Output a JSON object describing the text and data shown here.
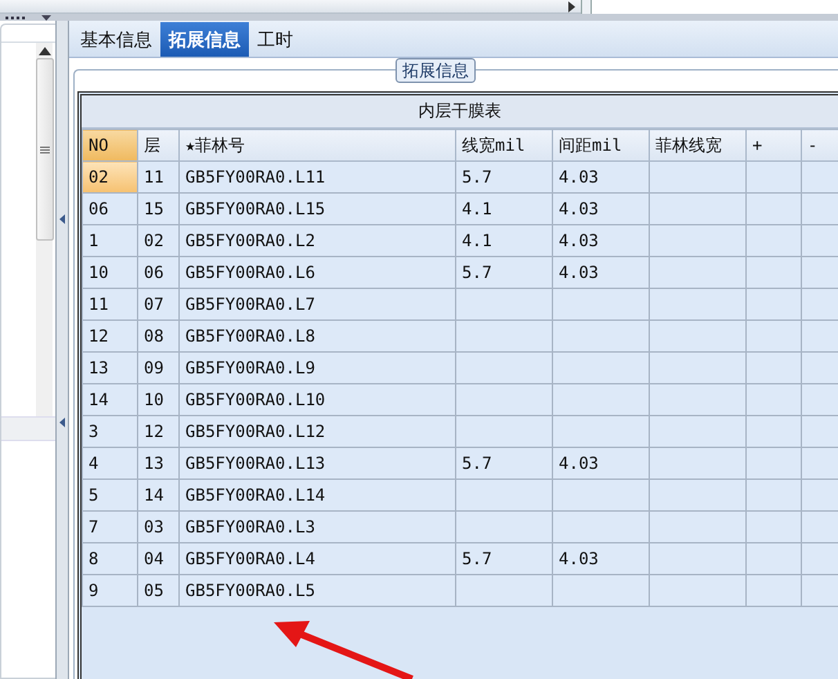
{
  "tabs": [
    {
      "label": "基本信息",
      "selected": false
    },
    {
      "label": "拓展信息",
      "selected": true
    },
    {
      "label": "工时",
      "selected": false
    }
  ],
  "group": {
    "title": "拓展信息"
  },
  "table": {
    "title": "内层干膜表",
    "columns": [
      "NO",
      "层",
      "★菲林号",
      "线宽mil",
      "间距mil",
      "菲林线宽",
      "+",
      "-"
    ],
    "rows": [
      {
        "selected": true,
        "cells": [
          "02",
          "11",
          "GB5FY00RA0.L11",
          "5.7",
          "4.03",
          "",
          "",
          ""
        ]
      },
      {
        "selected": false,
        "cells": [
          "06",
          "15",
          "GB5FY00RA0.L15",
          "4.1",
          "4.03",
          "",
          "",
          ""
        ]
      },
      {
        "selected": false,
        "cells": [
          "1",
          "02",
          "GB5FY00RA0.L2",
          "4.1",
          "4.03",
          "",
          "",
          ""
        ]
      },
      {
        "selected": false,
        "cells": [
          "10",
          "06",
          "GB5FY00RA0.L6",
          "5.7",
          "4.03",
          "",
          "",
          ""
        ]
      },
      {
        "selected": false,
        "cells": [
          "11",
          "07",
          "GB5FY00RA0.L7",
          "",
          "",
          "",
          "",
          ""
        ]
      },
      {
        "selected": false,
        "cells": [
          "12",
          "08",
          "GB5FY00RA0.L8",
          "",
          "",
          "",
          "",
          ""
        ]
      },
      {
        "selected": false,
        "cells": [
          "13",
          "09",
          "GB5FY00RA0.L9",
          "",
          "",
          "",
          "",
          ""
        ]
      },
      {
        "selected": false,
        "cells": [
          "14",
          "10",
          "GB5FY00RA0.L10",
          "",
          "",
          "",
          "",
          ""
        ]
      },
      {
        "selected": false,
        "cells": [
          "3",
          "12",
          "GB5FY00RA0.L12",
          "",
          "",
          "",
          "",
          ""
        ]
      },
      {
        "selected": false,
        "cells": [
          "4",
          "13",
          "GB5FY00RA0.L13",
          "5.7",
          "4.03",
          "",
          "",
          ""
        ]
      },
      {
        "selected": false,
        "cells": [
          "5",
          "14",
          "GB5FY00RA0.L14",
          "",
          "",
          "",
          "",
          ""
        ]
      },
      {
        "selected": false,
        "cells": [
          "7",
          "03",
          "GB5FY00RA0.L3",
          "",
          "",
          "",
          "",
          ""
        ]
      },
      {
        "selected": false,
        "cells": [
          "8",
          "04",
          "GB5FY00RA0.L4",
          "5.7",
          "4.03",
          "",
          "",
          ""
        ]
      },
      {
        "selected": false,
        "cells": [
          "9",
          "05",
          "GB5FY00RA0.L5",
          "",
          "",
          "",
          "",
          ""
        ]
      }
    ]
  }
}
